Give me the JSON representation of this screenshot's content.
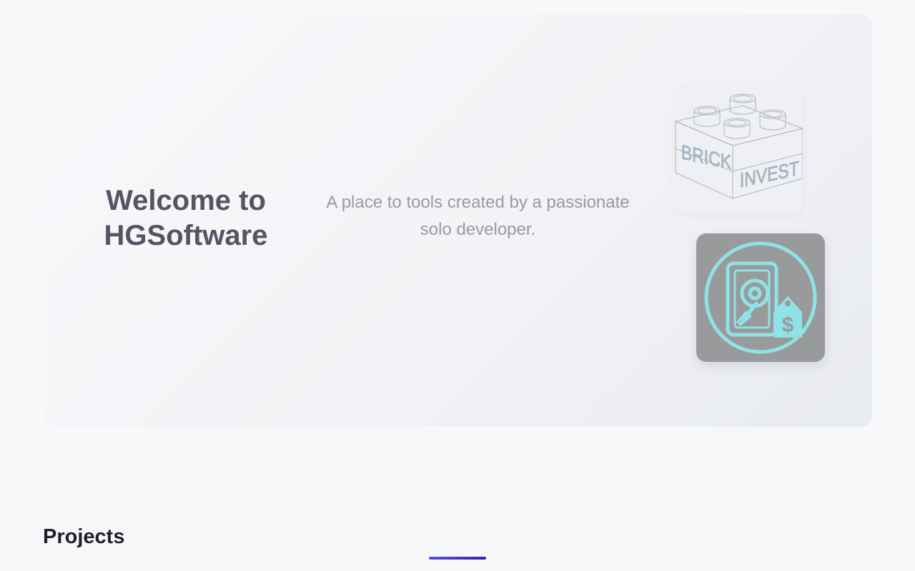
{
  "hero": {
    "title": "Welcome to HGSoftware",
    "subtitle": "A place to tools created by a passionate solo developer.",
    "images": [
      {
        "name": "brick-invest-logo",
        "text": "BRICK INVEST",
        "icon": "lego-brick-icon"
      },
      {
        "name": "disk-price-logo",
        "icon": "hard-drive-price-tag-icon"
      }
    ]
  },
  "projects": {
    "heading": "Projects"
  },
  "colors": {
    "accent": "#4b3fd0",
    "title": "#545463",
    "subtitle": "#9a9aa0",
    "heading": "#1f1f2e",
    "disk_icon": "#8fe3e6",
    "disk_background": "#999a9b"
  }
}
